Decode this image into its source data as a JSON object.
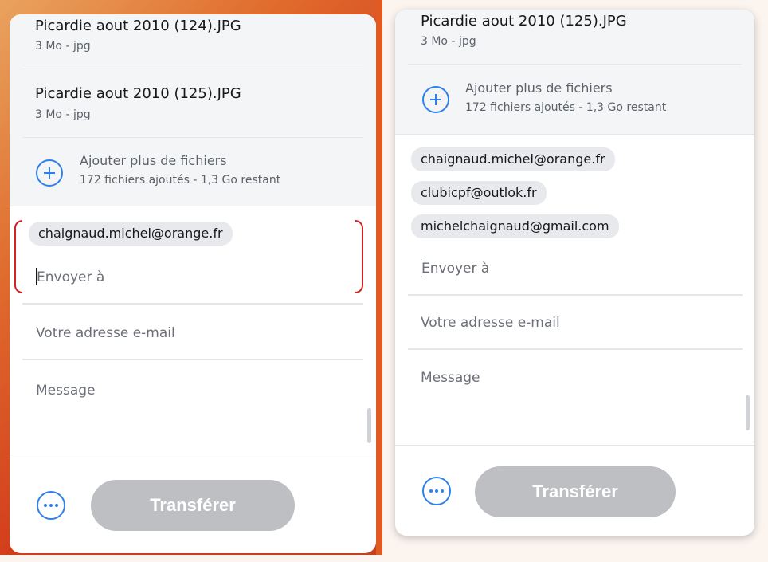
{
  "left": {
    "files": [
      {
        "name": "Picardie aout 2010 (124).JPG",
        "meta": "3 Mo - jpg"
      },
      {
        "name": "Picardie aout 2010 (125).JPG",
        "meta": "3 Mo - jpg"
      }
    ],
    "add_more": {
      "title": "Ajouter plus de fichiers",
      "subtitle": "172 fichiers ajoutés - 1,3 Go restant"
    },
    "recipients": [
      "chaignaud.michel@orange.fr"
    ],
    "send_to_placeholder": "Envoyer à",
    "email_placeholder": "Votre adresse e-mail",
    "message_placeholder": "Message",
    "transfer_label": "Transférer"
  },
  "right": {
    "files": [
      {
        "name": "Picardie aout 2010 (125).JPG",
        "meta": "3 Mo - jpg"
      }
    ],
    "add_more": {
      "title": "Ajouter plus de fichiers",
      "subtitle": "172 fichiers ajoutés - 1,3 Go restant"
    },
    "recipients": [
      "chaignaud.michel@orange.fr",
      "clubicpf@outlok.fr",
      "michelchaignaud@gmail.com"
    ],
    "send_to_placeholder": "Envoyer à",
    "email_placeholder": "Votre adresse e-mail",
    "message_placeholder": "Message",
    "transfer_label": "Transférer"
  },
  "colors": {
    "accent": "#2f80ed",
    "highlight": "#d42020",
    "button_disabled": "#bdbfc3",
    "background_left": "#d43d1c"
  },
  "icons": {
    "add": "plus-circle-icon",
    "more": "more-options-icon"
  }
}
